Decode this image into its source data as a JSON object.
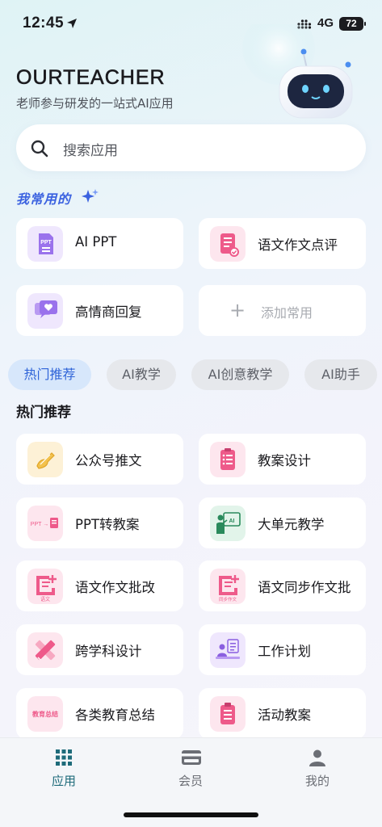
{
  "status": {
    "time": "12:45",
    "network": "4G",
    "battery": "72"
  },
  "header": {
    "brand": "OURTEACHER",
    "subtitle": "老师参与研发的一站式AI应用"
  },
  "search": {
    "placeholder": "搜索应用"
  },
  "favorites": {
    "title": "我常用的",
    "items": [
      {
        "label": "AI PPT",
        "icon": "ppt-icon"
      },
      {
        "label": "语文作文点评",
        "icon": "essay-review-icon"
      },
      {
        "label": "高情商回复",
        "icon": "chat-heart-icon"
      }
    ],
    "add_label": "添加常用"
  },
  "tabs": [
    "热门推荐",
    "AI教学",
    "AI创意教学",
    "AI助手"
  ],
  "section_title": "热门推荐",
  "apps": [
    {
      "label": "公众号推文",
      "icon": "pen-hand-icon",
      "badge": ""
    },
    {
      "label": "教案设计",
      "icon": "clipboard-list-icon",
      "badge": ""
    },
    {
      "label": "PPT转教案",
      "icon": "ppt-convert-icon",
      "badge": "PPT →"
    },
    {
      "label": "大单元教学",
      "icon": "teacher-board-icon",
      "badge": "AI"
    },
    {
      "label": "语文作文批改",
      "icon": "chinese-edit-icon",
      "badge": "语文"
    },
    {
      "label": "语文同步作文批",
      "icon": "sync-edit-icon",
      "badge": "同步作文"
    },
    {
      "label": "跨学科设计",
      "icon": "ruler-pencil-icon",
      "badge": ""
    },
    {
      "label": "工作计划",
      "icon": "work-plan-icon",
      "badge": ""
    },
    {
      "label": "各类教育总结",
      "icon": "summary-icon",
      "badge": "教育总结"
    },
    {
      "label": "活动教案",
      "icon": "clipboard-icon",
      "badge": ""
    }
  ],
  "bottom_nav": [
    {
      "label": "应用",
      "icon": "grid-icon",
      "active": true
    },
    {
      "label": "会员",
      "icon": "card-icon",
      "active": false
    },
    {
      "label": "我的",
      "icon": "user-icon",
      "active": false
    }
  ],
  "colors": {
    "accent": "#3b62e0",
    "nav_active": "#1e6b7a",
    "pink_icon": "#ee5a8a",
    "purple_icon": "#8a5fe0",
    "yellow_icon": "#e6b23c",
    "green_icon": "#2a8a5c"
  }
}
